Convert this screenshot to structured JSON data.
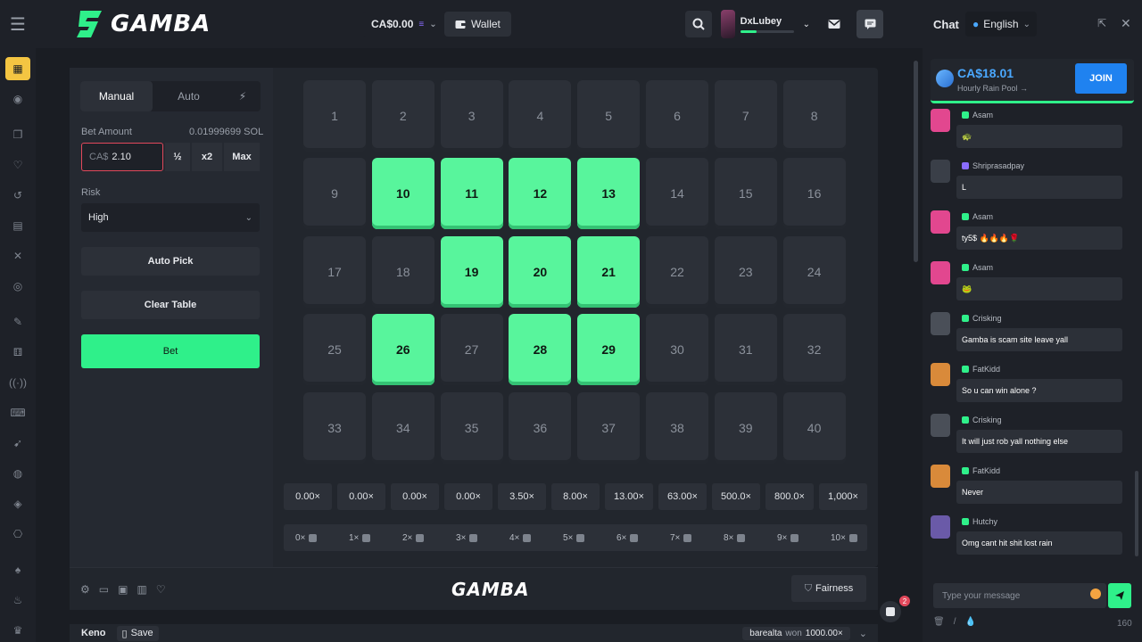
{
  "header": {
    "logo_text": "GAMBA",
    "balance": "CA$0.00",
    "wallet_label": "Wallet",
    "username": "DxLubey",
    "xp_fraction": 0.3
  },
  "sidebar": {
    "icons": [
      "cards-icon",
      "avatar-icon",
      "bookmark-icon",
      "heart-icon",
      "history-icon",
      "chart-icon",
      "swords-icon",
      "target-icon",
      "feather-icon",
      "dice-icon",
      "live-icon",
      "gamepad-icon",
      "rocket-icon",
      "ball-icon",
      "football-icon",
      "bottle-icon",
      "spade-icon",
      "fire-icon",
      "cup-icon"
    ]
  },
  "panel": {
    "tabs": [
      "Manual",
      "Auto"
    ],
    "bet_amount_label": "Bet Amount",
    "bet_amount_sol": "0.01999699 SOL",
    "bet_currency": "CA$",
    "bet_value": "2.10",
    "half_label": "½",
    "double_label": "x2",
    "max_label": "Max",
    "risk_label": "Risk",
    "risk_value": "High",
    "auto_pick_label": "Auto Pick",
    "clear_table_label": "Clear Table",
    "bet_button_label": "Bet"
  },
  "board": {
    "numbers": [
      "1",
      "2",
      "3",
      "4",
      "5",
      "6",
      "7",
      "8",
      "9",
      "10",
      "11",
      "12",
      "13",
      "14",
      "15",
      "16",
      "17",
      "18",
      "19",
      "20",
      "21",
      "22",
      "23",
      "24",
      "25",
      "26",
      "27",
      "28",
      "29",
      "30",
      "31",
      "32",
      "33",
      "34",
      "35",
      "36",
      "37",
      "38",
      "39",
      "40"
    ],
    "selected": [
      10,
      11,
      12,
      13,
      19,
      20,
      21,
      26,
      28,
      29
    ]
  },
  "multipliers": [
    "0.00×",
    "0.00×",
    "0.00×",
    "0.00×",
    "3.50×",
    "8.00×",
    "13.00×",
    "63.00×",
    "500.0×",
    "800.0×",
    "1,000×"
  ],
  "hits": [
    "0×",
    "1×",
    "2×",
    "3×",
    "4×",
    "5×",
    "6×",
    "7×",
    "8×",
    "9×",
    "10×"
  ],
  "footer": {
    "logo_text": "GAMBA",
    "fairness_label": "Fairness",
    "game_name": "Keno",
    "save_label": "Save",
    "winner_text": "barealta",
    "won_text": "won",
    "won_amount": "1000.00×",
    "notification_count": "2"
  },
  "chat": {
    "title": "Chat",
    "language": "English",
    "rain_amount": "CA$18.01",
    "rain_label": "Hourly Rain Pool →",
    "join_label": "JOIN",
    "messages": [
      {
        "user": "Asam",
        "text": "🐢",
        "avatar_color": "#e2478f"
      },
      {
        "user": "Shriprasadpay",
        "text": "L",
        "avatar_color": "#3a3f48"
      },
      {
        "user": "Asam",
        "text": "ty5$ 🔥🔥🔥🌹",
        "avatar_color": "#e2478f"
      },
      {
        "user": "Asam",
        "text": "🐸",
        "avatar_color": "#e2478f"
      },
      {
        "user": "Crisking",
        "text": "Gamba is scam site leave yall",
        "avatar_color": "#4a4f58"
      },
      {
        "user": "FatKidd",
        "text": "So u can win alone ?",
        "avatar_color": "#d98a3a"
      },
      {
        "user": "Crisking",
        "text": "It will just rob yall nothing else",
        "avatar_color": "#4a4f58"
      },
      {
        "user": "FatKidd",
        "text": "Never",
        "avatar_color": "#d98a3a"
      },
      {
        "user": "Hutchy",
        "text": "Omg cant hit shit lost rain",
        "avatar_color": "#6a5aa8"
      }
    ],
    "input_placeholder": "Type your message",
    "char_count": "160"
  }
}
